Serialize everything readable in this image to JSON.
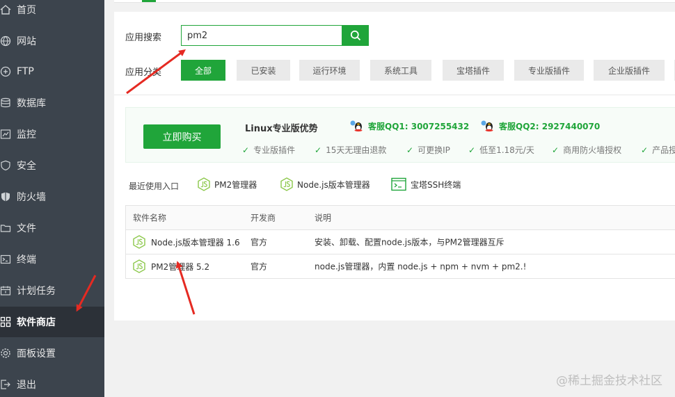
{
  "sidebar": {
    "items": [
      {
        "label": "首页",
        "icon": "home-icon"
      },
      {
        "label": "网站",
        "icon": "globe-icon"
      },
      {
        "label": "FTP",
        "icon": "ftp-icon"
      },
      {
        "label": "数据库",
        "icon": "database-icon"
      },
      {
        "label": "监控",
        "icon": "monitor-icon"
      },
      {
        "label": "安全",
        "icon": "shield-icon"
      },
      {
        "label": "防火墙",
        "icon": "firewall-icon"
      },
      {
        "label": "文件",
        "icon": "folder-icon"
      },
      {
        "label": "终端",
        "icon": "terminal-icon"
      },
      {
        "label": "计划任务",
        "icon": "calendar-icon"
      },
      {
        "label": "软件商店",
        "icon": "grid-icon"
      },
      {
        "label": "面板设置",
        "icon": "gear-icon"
      },
      {
        "label": "退出",
        "icon": "logout-icon"
      }
    ],
    "active": "软件商店"
  },
  "search": {
    "label": "应用搜索",
    "value": "pm2"
  },
  "categories": {
    "label": "应用分类",
    "items": [
      "全部",
      "已安装",
      "运行环境",
      "系统工具",
      "宝塔插件",
      "专业版插件",
      "企业版插件"
    ],
    "active": "全部"
  },
  "promo": {
    "buy_label": "立即购买",
    "title": "Linux专业版优势",
    "qq1": "客服QQ1: 3007255432",
    "qq2": "客服QQ2: 2927440070",
    "features": [
      "专业版插件",
      "15天无理由退款",
      "可更换IP",
      "低至1.18元/天",
      "商用防火墙授权",
      "产品授"
    ]
  },
  "recent": {
    "label": "最近使用入口",
    "items": [
      "PM2管理器",
      "Node.js版本管理器",
      "宝塔SSH终端"
    ]
  },
  "table": {
    "headers": [
      "软件名称",
      "开发商",
      "说明"
    ],
    "rows": [
      {
        "name": "Node.js版本管理器 1.6",
        "vendor": "官方",
        "desc": "安装、卸载、配置node.js版本，与PM2管理器互斥"
      },
      {
        "name": "PM2管理器 5.2",
        "vendor": "官方",
        "desc": "node.js管理器，内置 node.js + npm + nvm + pm2.!"
      }
    ]
  },
  "watermark": "@稀土掘金技术社区",
  "colors": {
    "accent": "#20a53a",
    "sidebar_bg": "#3c444d",
    "sidebar_active_bg": "#2c3138",
    "annotation_red": "#e52a22"
  }
}
